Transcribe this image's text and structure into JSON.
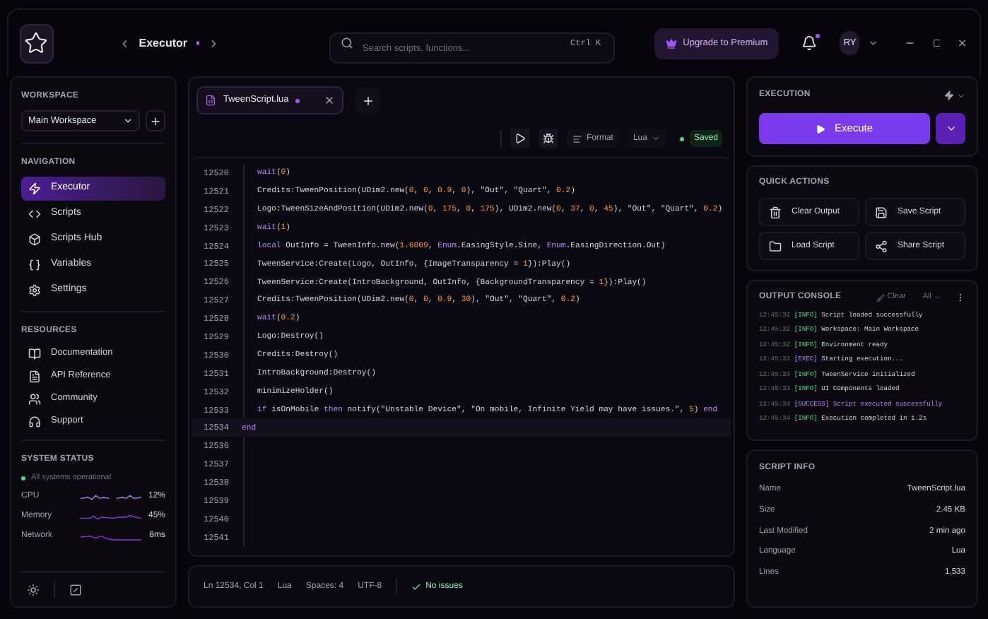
{
  "topbar": {
    "page_title": "Executor",
    "modified": true,
    "search": {
      "placeholder": "Search scripts, functions...",
      "shortcut": "Ctrl K"
    },
    "upgrade": "Upgrade to Premium",
    "notifications_unread": true,
    "avatar": "RY"
  },
  "sidebar": {
    "workspace_label": "WORKSPACE",
    "workspace": "Main Workspace",
    "navigation_label": "NAVIGATION",
    "navigation": [
      {
        "label": "Executor",
        "selected": true
      },
      {
        "label": "Scripts",
        "selected": false
      },
      {
        "label": "Scripts Hub",
        "selected": false
      },
      {
        "label": "Variables",
        "selected": false
      },
      {
        "label": "Settings",
        "selected": false
      }
    ],
    "resources_label": "RESOURCES",
    "resources": [
      "Documentation",
      "API Reference",
      "Community",
      "Support"
    ],
    "status": {
      "title": "SYSTEM STATUS",
      "message": "All systems operational",
      "color": "#4ade80",
      "metrics": [
        {
          "name": "CPU",
          "value": "12%"
        },
        {
          "name": "Memory",
          "value": "45%"
        },
        {
          "name": "Network",
          "value": "8ms"
        }
      ]
    }
  },
  "editor": {
    "tabs": [
      {
        "label": "TweenScript.lua",
        "modified": true,
        "selected": true
      }
    ],
    "toolbar": {
      "format": "Format",
      "language": "Lua",
      "status": "Saved"
    },
    "lines": [
      {
        "n": "12520",
        "current": false,
        "tokens": [
          {
            "t": "wait",
            "kind": "keyword"
          },
          {
            "t": "(",
            "kind": "plain"
          },
          {
            "t": "0",
            "kind": "number"
          },
          {
            "t": ")",
            "kind": "plain"
          }
        ]
      },
      {
        "n": "12521",
        "current": false,
        "tokens": [
          {
            "t": "Credits:TweenPosition(UDim2.new(",
            "kind": "plain"
          },
          {
            "t": "0",
            "kind": "number"
          },
          {
            "t": ", ",
            "kind": "plain"
          },
          {
            "t": "0",
            "kind": "number"
          },
          {
            "t": ", ",
            "kind": "plain"
          },
          {
            "t": "0.9",
            "kind": "number"
          },
          {
            "t": ", ",
            "kind": "plain"
          },
          {
            "t": "0",
            "kind": "number"
          },
          {
            "t": "), \"Out\", \"Quart\", ",
            "kind": "plain"
          },
          {
            "t": "0.2",
            "kind": "number"
          },
          {
            "t": ")",
            "kind": "plain"
          }
        ]
      },
      {
        "n": "12522",
        "current": false,
        "tokens": [
          {
            "t": "Logo:TweenSizeAndPosition(UDim2.new(",
            "kind": "plain"
          },
          {
            "t": "0",
            "kind": "number"
          },
          {
            "t": ", ",
            "kind": "plain"
          },
          {
            "t": "175",
            "kind": "number"
          },
          {
            "t": ", ",
            "kind": "plain"
          },
          {
            "t": "0",
            "kind": "number"
          },
          {
            "t": ", ",
            "kind": "plain"
          },
          {
            "t": "175",
            "kind": "number"
          },
          {
            "t": "), UDim2.new(",
            "kind": "plain"
          },
          {
            "t": "0",
            "kind": "number"
          },
          {
            "t": ", ",
            "kind": "plain"
          },
          {
            "t": "37",
            "kind": "number"
          },
          {
            "t": ", ",
            "kind": "plain"
          },
          {
            "t": "0",
            "kind": "number"
          },
          {
            "t": ", ",
            "kind": "plain"
          },
          {
            "t": "45",
            "kind": "number"
          },
          {
            "t": "), \"Out\", \"Quart\", ",
            "kind": "plain"
          },
          {
            "t": "0.2",
            "kind": "number"
          },
          {
            "t": ")",
            "kind": "plain"
          }
        ]
      },
      {
        "n": "12523",
        "current": false,
        "tokens": [
          {
            "t": "wait",
            "kind": "keyword"
          },
          {
            "t": "(",
            "kind": "plain"
          },
          {
            "t": "1",
            "kind": "number"
          },
          {
            "t": ")",
            "kind": "plain"
          }
        ]
      },
      {
        "n": "12524",
        "current": false,
        "tokens": [
          {
            "t": "local",
            "kind": "keyword"
          },
          {
            "t": " OutInfo = TweenInfo.new(",
            "kind": "plain"
          },
          {
            "t": "1.6009",
            "kind": "number"
          },
          {
            "t": ", ",
            "kind": "plain"
          },
          {
            "t": "Enum",
            "kind": "keyword"
          },
          {
            "t": ".EasingStyle.Sine, ",
            "kind": "plain"
          },
          {
            "t": "Enum",
            "kind": "keyword"
          },
          {
            "t": ".EasingDirection.Out)",
            "kind": "plain"
          }
        ]
      },
      {
        "n": "12525",
        "current": false,
        "tokens": [
          {
            "t": "TweenService:Create(Logo, OutInfo, {ImageTransparency = ",
            "kind": "plain"
          },
          {
            "t": "1",
            "kind": "number"
          },
          {
            "t": "}):Play()",
            "kind": "plain"
          }
        ]
      },
      {
        "n": "12526",
        "current": false,
        "tokens": [
          {
            "t": "TweenService:Create(IntroBackground, OutInfo, {BackgroundTransparency = ",
            "kind": "plain"
          },
          {
            "t": "1",
            "kind": "number"
          },
          {
            "t": "}):Play()",
            "kind": "plain"
          }
        ]
      },
      {
        "n": "12527",
        "current": false,
        "tokens": [
          {
            "t": "Credits:TweenPosition(UDim2.new(",
            "kind": "plain"
          },
          {
            "t": "0",
            "kind": "number"
          },
          {
            "t": ", ",
            "kind": "plain"
          },
          {
            "t": "0",
            "kind": "number"
          },
          {
            "t": ", ",
            "kind": "plain"
          },
          {
            "t": "0.9",
            "kind": "number"
          },
          {
            "t": ", ",
            "kind": "plain"
          },
          {
            "t": "30",
            "kind": "number"
          },
          {
            "t": "), \"Out\", \"Quart\", ",
            "kind": "plain"
          },
          {
            "t": "0.2",
            "kind": "number"
          },
          {
            "t": ")",
            "kind": "plain"
          }
        ]
      },
      {
        "n": "12528",
        "current": false,
        "tokens": [
          {
            "t": "wait",
            "kind": "keyword"
          },
          {
            "t": "(",
            "kind": "plain"
          },
          {
            "t": "0.2",
            "kind": "number"
          },
          {
            "t": ")",
            "kind": "plain"
          }
        ]
      },
      {
        "n": "12529",
        "current": false,
        "tokens": [
          {
            "t": "Logo:Destroy()",
            "kind": "plain"
          }
        ]
      },
      {
        "n": "12530",
        "current": false,
        "tokens": [
          {
            "t": "Credits:Destroy()",
            "kind": "plain"
          }
        ]
      },
      {
        "n": "12531",
        "current": false,
        "tokens": [
          {
            "t": "IntroBackground:Destroy()",
            "kind": "plain"
          }
        ]
      },
      {
        "n": "12532",
        "current": false,
        "tokens": [
          {
            "t": "minimizeHolder()",
            "kind": "plain"
          }
        ]
      },
      {
        "n": "12533",
        "current": false,
        "tokens": [
          {
            "t": "if",
            "kind": "keyword"
          },
          {
            "t": " isOnMobile ",
            "kind": "plain"
          },
          {
            "t": "then",
            "kind": "keyword"
          },
          {
            "t": " notify(\"Unstable Device\", \"On mobile, Infinite Yield may have issues.\", ",
            "kind": "plain"
          },
          {
            "t": "5",
            "kind": "number"
          },
          {
            "t": ") ",
            "kind": "plain"
          },
          {
            "t": "end",
            "kind": "keyword"
          }
        ]
      },
      {
        "n": "12534",
        "current": true,
        "tokens": [
          {
            "t": "end",
            "kind": "keyword"
          }
        ]
      },
      {
        "n": "12536",
        "current": false
      },
      {
        "n": "12537",
        "current": false
      },
      {
        "n": "12538",
        "current": false
      },
      {
        "n": "12539",
        "current": false
      },
      {
        "n": "12540",
        "current": false
      },
      {
        "n": "12541",
        "current": false
      }
    ],
    "statusbar": [
      "Ln 12534, Col 1",
      "Lua",
      "Spaces: 4",
      "UTF-8"
    ],
    "issues": "No issues"
  },
  "execution": {
    "title": "EXECUTION",
    "button": "Execute"
  },
  "quick_actions": {
    "title": "QUICK ACTIONS",
    "buttons": [
      "Clear Output",
      "Save Script",
      "Load Script",
      "Share Script"
    ]
  },
  "console": {
    "title": "OUTPUT CONSOLE",
    "clear": "Clear",
    "filter": "All",
    "lines": [
      {
        "time": "12:45:32",
        "tag": "[INFO]",
        "kind": "info",
        "message": "Script loaded successfully"
      },
      {
        "time": "12:45:32",
        "tag": "[INFO]",
        "kind": "info",
        "message": "Workspace: Main Workspace"
      },
      {
        "time": "12:45:32",
        "tag": "[INFO]",
        "kind": "info",
        "message": "Environment ready"
      },
      {
        "time": "12:45:33",
        "tag": "[EXEC]",
        "kind": "exec",
        "message": "Starting execution..."
      },
      {
        "time": "12:45:33",
        "tag": "[INFO]",
        "kind": "info",
        "message": "TweenService initialized"
      },
      {
        "time": "12:45:33",
        "tag": "[INFO]",
        "kind": "info",
        "message": "UI Components loaded"
      },
      {
        "time": "12:45:34",
        "tag": "[SUCCESS]",
        "kind": "success",
        "message": "Script executed successfully"
      },
      {
        "time": "12:45:34",
        "tag": "[INFO]",
        "kind": "info",
        "message": "Execution completed in 1.2s"
      }
    ]
  },
  "script_info": {
    "title": "SCRIPT INFO",
    "rows": [
      {
        "label": "Name",
        "value": "TweenScript.lua"
      },
      {
        "label": "Size",
        "value": "2.45 KB"
      },
      {
        "label": "Last Modified",
        "value": "2 min ago"
      },
      {
        "label": "Language",
        "value": "Lua"
      },
      {
        "label": "Lines",
        "value": "1,533"
      }
    ]
  }
}
